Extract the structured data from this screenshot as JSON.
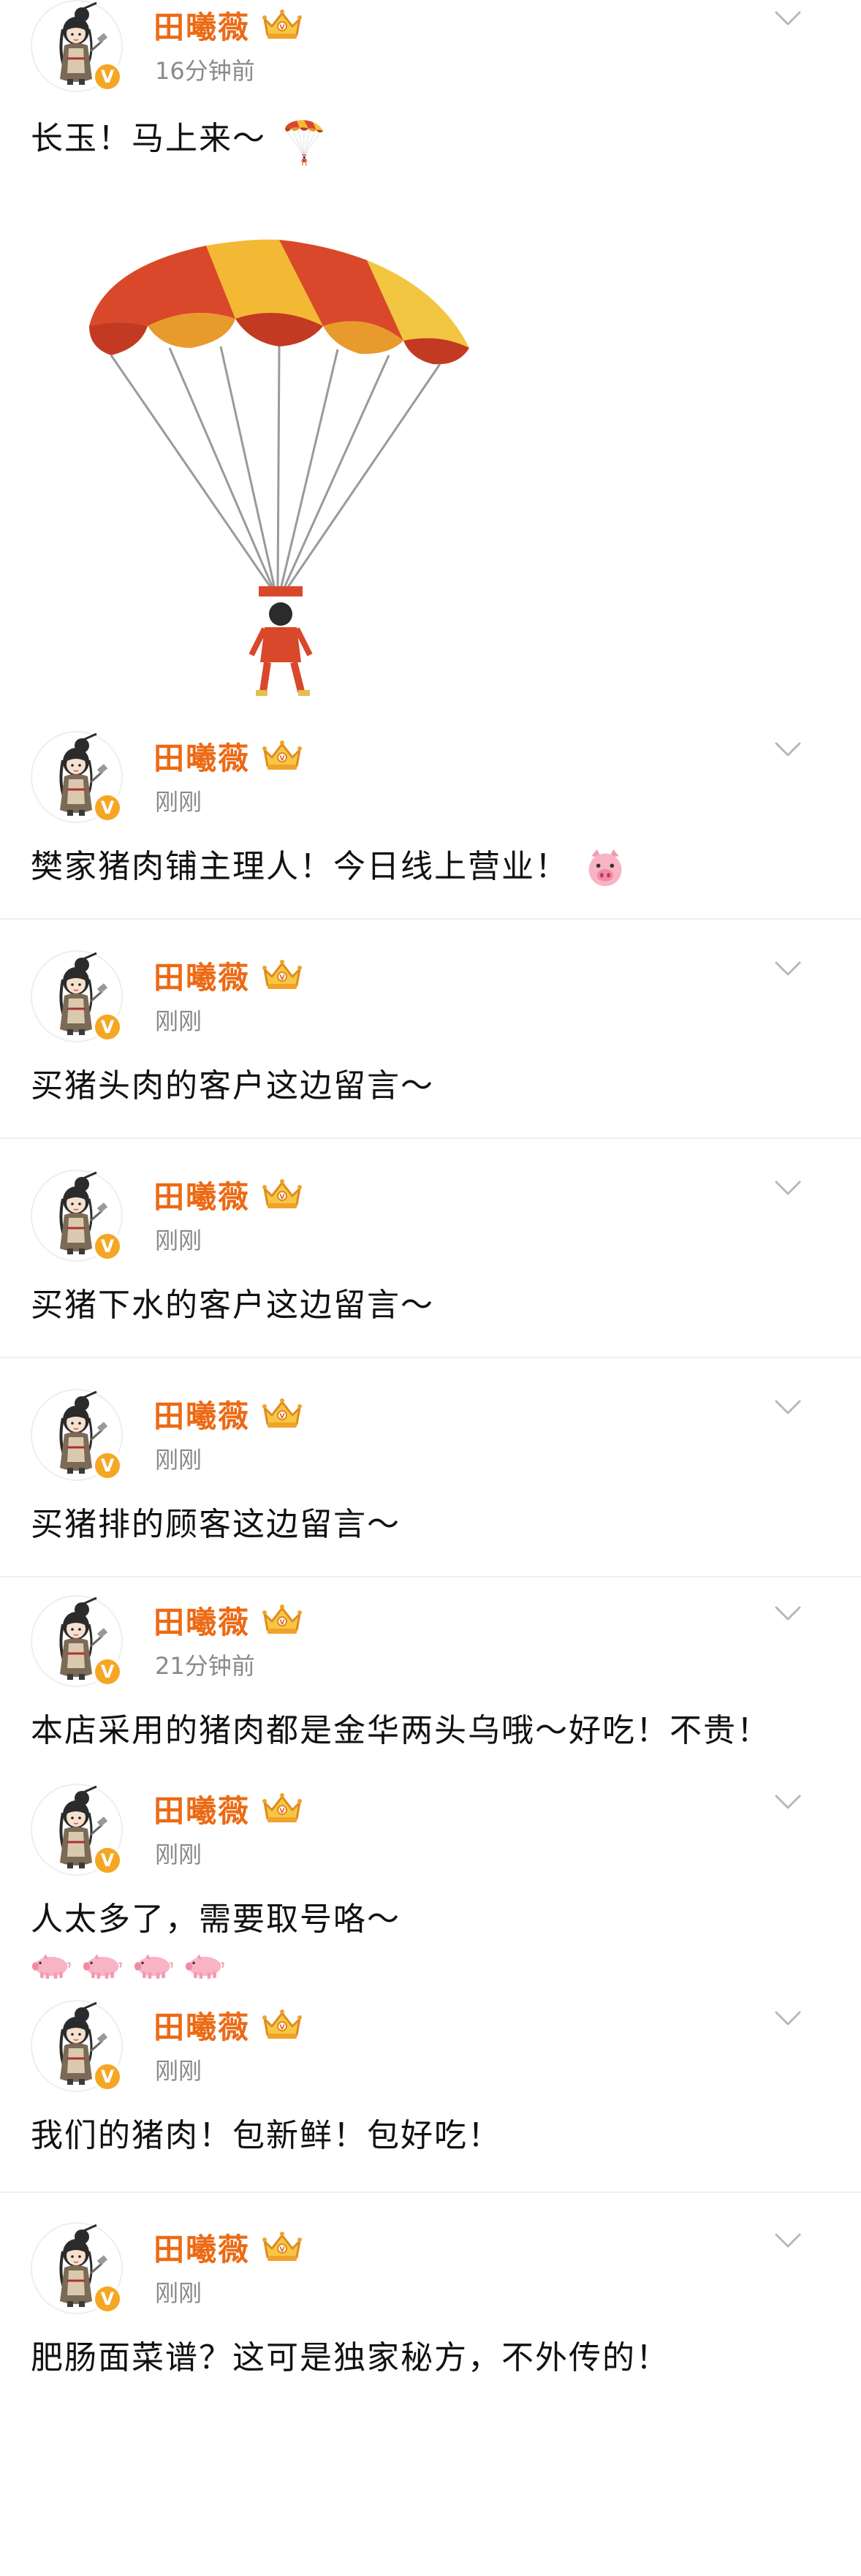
{
  "user": {
    "name": "田曦薇",
    "verified_mark": "V"
  },
  "posts": [
    {
      "time": "16分钟前",
      "text": "长玉！马上来～",
      "emoji": "parachute-emoji"
    },
    {
      "time": "刚刚",
      "text": "樊家猪肉铺主理人！今日线上营业！",
      "emoji": "pig-face-emoji"
    },
    {
      "time": "刚刚",
      "text": "买猪头肉的客户这边留言～"
    },
    {
      "time": "刚刚",
      "text": "买猪下水的客户这边留言～"
    },
    {
      "time": "刚刚",
      "text": "买猪排的顾客这边留言～"
    },
    {
      "time": "21分钟前",
      "text": "本店采用的猪肉都是金华两头乌哦～好吃！不贵！"
    },
    {
      "time": "刚刚",
      "text": "人太多了，需要取号咯～",
      "emoji": "pig-emoji"
    },
    {
      "time": "刚刚",
      "text": "我们的猪肉！包新鲜！包好吃！"
    },
    {
      "time": "刚刚",
      "text": "肥肠面菜谱？这可是独家秘方，不外传的！"
    }
  ],
  "colors": {
    "username": "#ec6a14",
    "time": "#8a8a8a",
    "badge": "#f5a623",
    "divider": "#f0f0f0"
  },
  "icons": [
    "crown-badge-icon",
    "chevron-down-icon",
    "verified-badge-icon",
    "parachute-emoji",
    "pig-face-emoji",
    "pig-emoji"
  ]
}
